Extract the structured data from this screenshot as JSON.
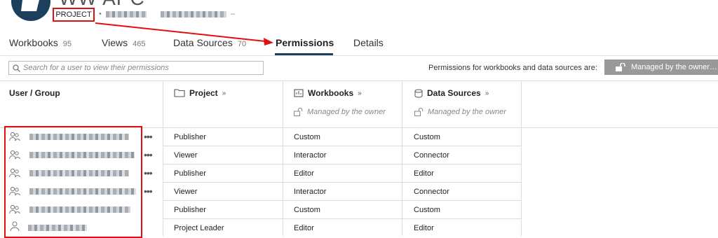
{
  "project": {
    "title": "WW APC",
    "type_badge": "PROJECT",
    "owner_separator": "•",
    "owner_trailing": "–"
  },
  "tabs": [
    {
      "label": "Workbooks",
      "count": "95"
    },
    {
      "label": "Views",
      "count": "465"
    },
    {
      "label": "Data Sources",
      "count": "70"
    },
    {
      "label": "Permissions",
      "count": ""
    },
    {
      "label": "Details",
      "count": ""
    }
  ],
  "toolbar": {
    "search_placeholder": "Search for a user to view their permissions",
    "managed_label": "Permissions for workbooks and data sources are:",
    "managed_button": "Managed by the owner…"
  },
  "table": {
    "headers": {
      "user_group": "User / Group",
      "project": "Project",
      "workbooks": "Workbooks",
      "data_sources": "Data Sources",
      "arrow": "»"
    },
    "managed_note": "Managed by the owner",
    "rows": [
      {
        "project": "Publisher",
        "workbooks": "Custom",
        "data_sources": "Custom",
        "icon": "group-icon"
      },
      {
        "project": "Viewer",
        "workbooks": "Interactor",
        "data_sources": "Connector",
        "icon": "group-icon"
      },
      {
        "project": "Publisher",
        "workbooks": "Editor",
        "data_sources": "Editor",
        "icon": "group-icon"
      },
      {
        "project": "Viewer",
        "workbooks": "Interactor",
        "data_sources": "Connector",
        "icon": "group-icon"
      },
      {
        "project": "Publisher",
        "workbooks": "Custom",
        "data_sources": "Custom",
        "icon": "group-icon"
      },
      {
        "project": "Project Leader",
        "workbooks": "Editor",
        "data_sources": "Editor",
        "icon": "user-icon"
      }
    ],
    "row_menu": "•••"
  },
  "colors": {
    "annotation_red": "#e01010",
    "brand_navy": "#1d3f5e",
    "managed_button_bg": "#999999"
  }
}
